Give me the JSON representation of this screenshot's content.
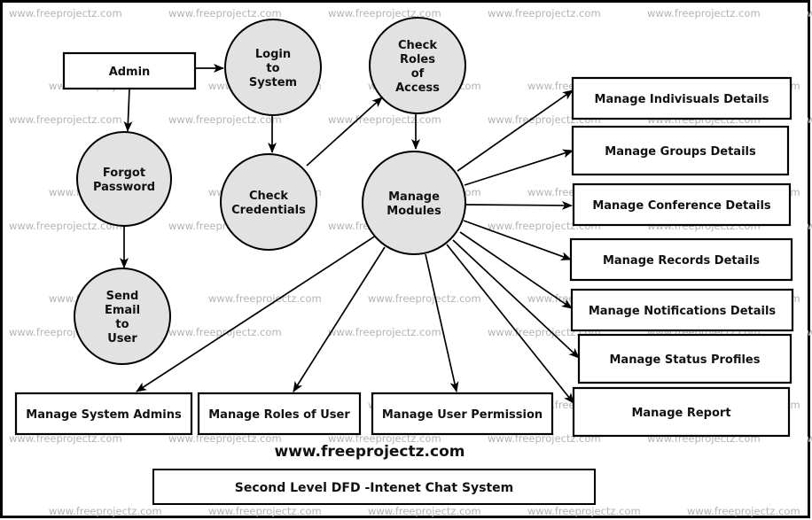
{
  "diagram": {
    "type": "data-flow-diagram",
    "title": "Second Level DFD -Intenet Chat System",
    "website_caption": "www.freeprojectz.com",
    "watermark_text": "www.freeprojectz.com",
    "colors": {
      "process_fill": "#e2e2e2",
      "entity_fill": "#ffffff",
      "stroke": "#000000",
      "watermark": "#b4b4b4"
    },
    "entities": [
      {
        "id": "admin",
        "label": "Admin"
      },
      {
        "id": "indiv",
        "label": "Manage Indivisuals Details"
      },
      {
        "id": "groups",
        "label": "Manage Groups Details"
      },
      {
        "id": "conf",
        "label": "Manage Conference Details"
      },
      {
        "id": "records",
        "label": "Manage Records Details"
      },
      {
        "id": "notif",
        "label": "Manage Notifications Details"
      },
      {
        "id": "status",
        "label": "Manage Status Profiles"
      },
      {
        "id": "report",
        "label": "Manage Report"
      },
      {
        "id": "sysadmins",
        "label": "Manage System Admins"
      },
      {
        "id": "roles",
        "label": "Manage Roles of User"
      },
      {
        "id": "perm",
        "label": "Manage User Permission"
      }
    ],
    "processes": [
      {
        "id": "login",
        "lines": [
          "Login",
          "to",
          "System"
        ]
      },
      {
        "id": "roleschk",
        "lines": [
          "Check",
          "Roles",
          "of",
          "Access"
        ]
      },
      {
        "id": "forgot",
        "lines": [
          "Forgot",
          "Password"
        ]
      },
      {
        "id": "creds",
        "lines": [
          "Check",
          "Credentials"
        ]
      },
      {
        "id": "modules",
        "lines": [
          "Manage",
          "Modules"
        ]
      },
      {
        "id": "email",
        "lines": [
          "Send",
          "Email",
          "to",
          "User"
        ]
      }
    ],
    "flows": [
      {
        "from": "admin",
        "to": "login"
      },
      {
        "from": "admin",
        "to": "forgot"
      },
      {
        "from": "login",
        "to": "creds"
      },
      {
        "from": "creds",
        "to": "roleschk"
      },
      {
        "from": "roleschk",
        "to": "modules"
      },
      {
        "from": "forgot",
        "to": "email"
      },
      {
        "from": "modules",
        "to": "indiv"
      },
      {
        "from": "modules",
        "to": "groups"
      },
      {
        "from": "modules",
        "to": "conf"
      },
      {
        "from": "modules",
        "to": "records"
      },
      {
        "from": "modules",
        "to": "notif"
      },
      {
        "from": "modules",
        "to": "status"
      },
      {
        "from": "modules",
        "to": "report"
      },
      {
        "from": "modules",
        "to": "sysadmins"
      },
      {
        "from": "modules",
        "to": "roles"
      },
      {
        "from": "modules",
        "to": "perm"
      }
    ]
  }
}
